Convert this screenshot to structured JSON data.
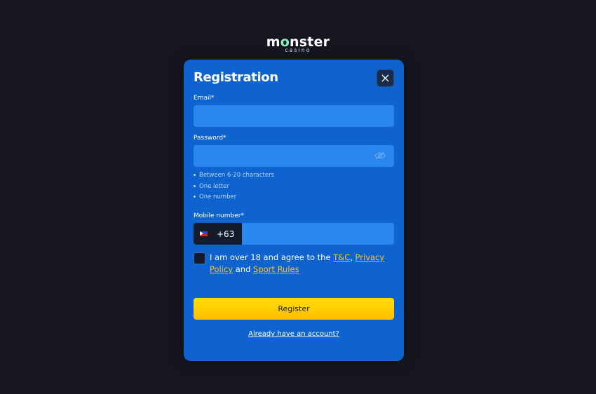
{
  "brand": {
    "logo_part1": "m",
    "logo_o": "o",
    "logo_part2": "nster",
    "logo_sub": "casino"
  },
  "modal": {
    "title": "Registration",
    "close_icon": "close-icon"
  },
  "form": {
    "email_label": "Email*",
    "email_value": "",
    "password_label": "Password*",
    "password_value": "",
    "password_toggle_icon": "eye-icon",
    "password_hints": [
      "Between 6-20 characters",
      "One letter",
      "One number"
    ],
    "mobile_label": "Mobile number*",
    "mobile_flag": "philippines-flag-icon",
    "mobile_code": "+63",
    "mobile_value": ""
  },
  "agreement": {
    "text_before": "I am over 18 and agree to the ",
    "tc_link": "T&C",
    "comma": ", ",
    "privacy_link": "Privacy Policy",
    "and": " and ",
    "sport_rules_link": "Sport Rules",
    "checked": false
  },
  "actions": {
    "register_label": "Register",
    "login_link": "Already have an account?"
  },
  "colors": {
    "background": "#15161f",
    "modal": "#0e63cf",
    "field": "#2a87ee",
    "accent_link": "#ffc21e",
    "button": "#ffd000"
  }
}
